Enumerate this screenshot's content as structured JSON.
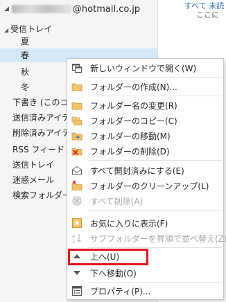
{
  "account": {
    "email_suffix": "@hotmail.co.jp"
  },
  "folders": [
    {
      "label": "受信トレイ",
      "expanded": true
    },
    {
      "label": "夏"
    },
    {
      "label": "春"
    },
    {
      "label": "秋"
    },
    {
      "label": "冬"
    },
    {
      "label": "下書き (このコ"
    },
    {
      "label": "送信済みアイテ"
    },
    {
      "label": "削除済みアイテ"
    },
    {
      "label": "RSS フィード"
    },
    {
      "label": "送信トレイ"
    },
    {
      "label": "迷惑メール"
    },
    {
      "label": "検索フォルダー"
    }
  ],
  "right_pane": {
    "top_text": "すべて   未読",
    "sub_text": "ここに"
  },
  "context_menu": {
    "items": [
      {
        "label": "新しいウィンドウで開く(W)",
        "icon": "new-window-icon",
        "enabled": true
      },
      {
        "label": "フォルダーの作成(N)...",
        "icon": "folder-icon",
        "enabled": true
      },
      {
        "label": "フォルダー名の変更(R)",
        "icon": "folder-rename-icon",
        "enabled": true
      },
      {
        "label": "フォルダーのコピー(C)",
        "icon": "folder-copy-icon",
        "enabled": true
      },
      {
        "label": "フォルダーの移動(M)",
        "icon": "folder-move-icon",
        "enabled": true
      },
      {
        "label": "フォルダーの削除(D)",
        "icon": "folder-delete-icon",
        "enabled": true
      },
      {
        "label": "すべて開封済みにする(E)",
        "icon": "mark-read-icon",
        "enabled": true
      },
      {
        "label": "フォルダーのクリーンアップ(L)",
        "icon": "cleanup-icon",
        "enabled": true
      },
      {
        "label": "すべて削除(A)",
        "icon": "delete-all-icon",
        "enabled": false
      },
      {
        "label": "お気に入りに表示(F)",
        "icon": "favorites-icon",
        "enabled": true
      },
      {
        "label": "サブフォルダーを昇順で並べ替え(Z)",
        "icon": "sort-icon",
        "enabled": false
      },
      {
        "label": "上へ(U)",
        "icon": "up-arrow-icon",
        "enabled": true
      },
      {
        "label": "下へ移動(O)",
        "icon": "down-arrow-icon",
        "enabled": true
      },
      {
        "label": "プロパティ(P)...",
        "icon": "properties-icon",
        "enabled": true
      }
    ]
  },
  "colors": {
    "highlight": "#e0141e",
    "selected": "#d5e8f8",
    "folder": "#f0c36d"
  }
}
